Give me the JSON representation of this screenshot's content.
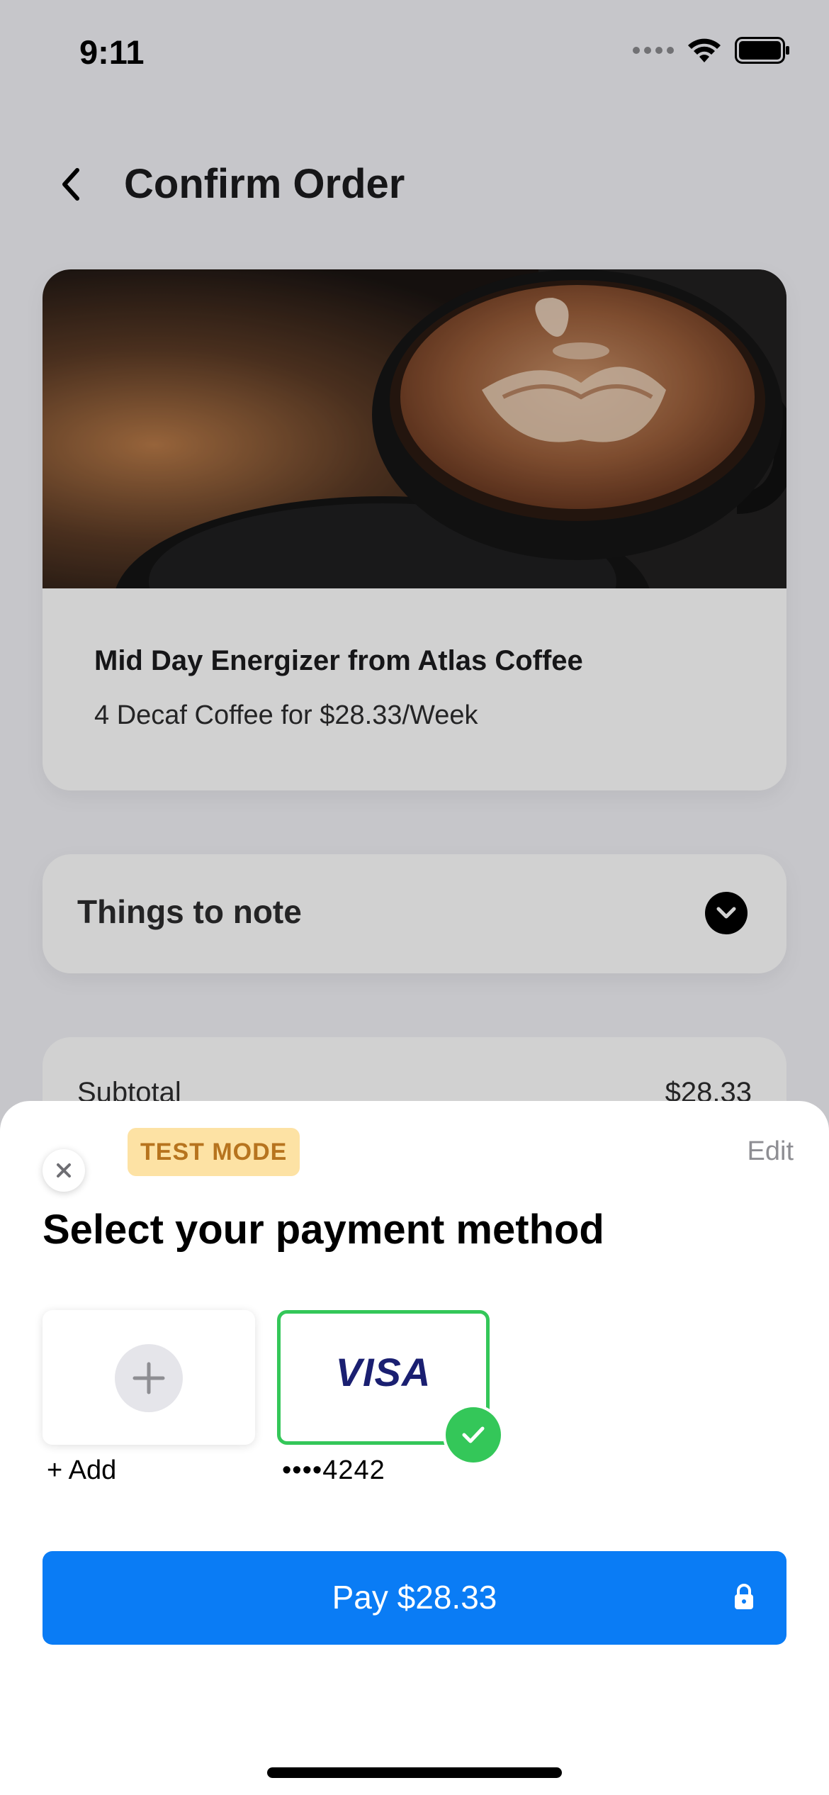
{
  "status_bar": {
    "time": "9:11"
  },
  "nav": {
    "title": "Confirm Order"
  },
  "product": {
    "name": "Mid Day Energizer from Atlas Coffee",
    "description": "4 Decaf Coffee for $28.33/Week"
  },
  "note": {
    "title": "Things to note"
  },
  "summary": {
    "subtotal_label": "Subtotal",
    "subtotal_value": "$28.33"
  },
  "sheet": {
    "badge": "TEST MODE",
    "edit_label": "Edit",
    "title": "Select your payment method",
    "add_label": "+ Add",
    "card_brand": "VISA",
    "card_label": "••••4242",
    "pay_label": "Pay $28.33"
  },
  "colors": {
    "accent": "#0a7cf5",
    "selected": "#34c759",
    "badge_bg": "#fde2a4",
    "badge_text": "#b7741e",
    "visa_blue": "#1a1f71"
  }
}
